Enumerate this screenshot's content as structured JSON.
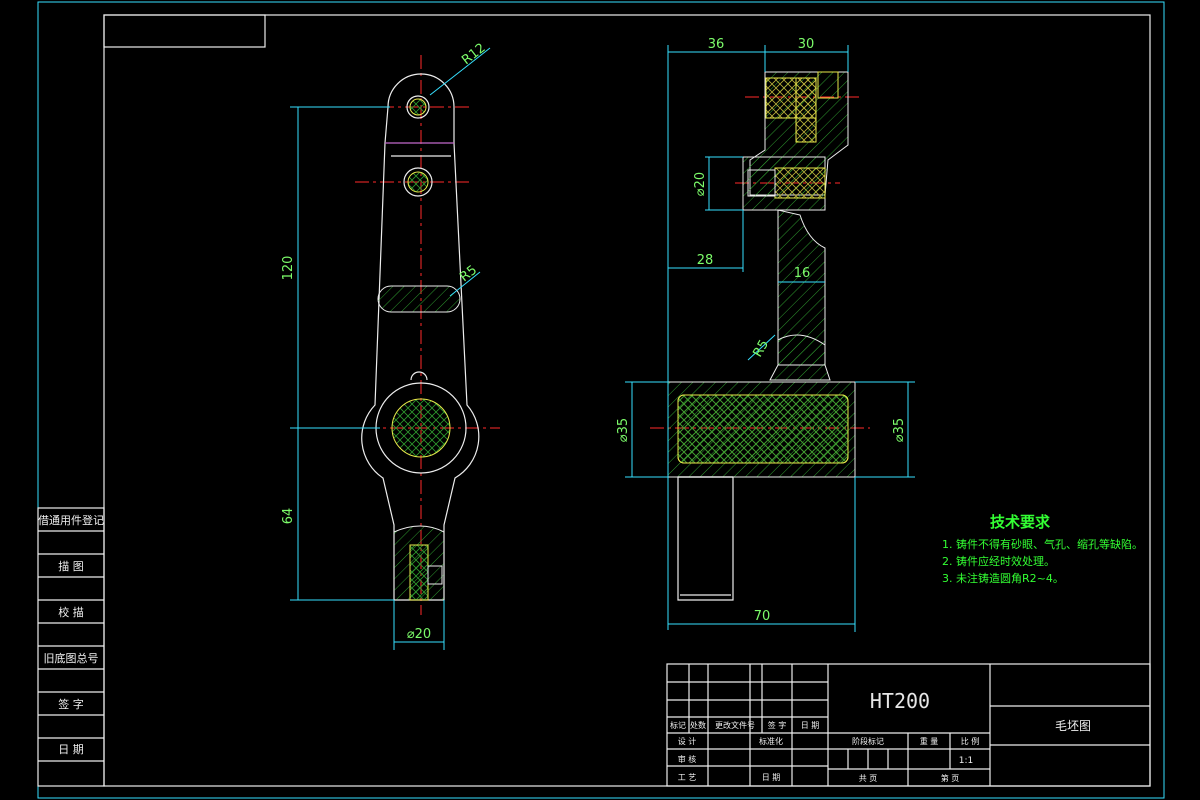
{
  "material": "HT200",
  "drawing_name": "毛坯图",
  "scale": "1:1",
  "tech_requirements": {
    "title": "技术要求",
    "items": [
      "1. 铸件不得有砂眼、气孔、缩孔等缺陷。",
      "2. 铸件应经时效处理。",
      "3. 未注铸造圆角R2~4。"
    ]
  },
  "left_side_labels": [
    "借通用件登记",
    "描 图",
    "校 描",
    "旧底图总号",
    "签 字",
    "日 期"
  ],
  "title_block": {
    "row_labels": [
      "标记",
      "处数",
      "更改文件号",
      "签 字",
      "日 期"
    ],
    "design": "设 计",
    "standardize": "标准化",
    "review": "审 核",
    "process": "工 艺",
    "date": "日 期",
    "stage_mark": "阶段标记",
    "weight": "重 量",
    "scale_label": "比 例",
    "total_pages": "共 页",
    "page_no": "第 页"
  },
  "front_view_dims": {
    "r12": "R12",
    "r5": "R5",
    "len120": "120",
    "len64": "64",
    "dia20": "⌀20"
  },
  "side_view_dims": {
    "w36": "36",
    "w30": "30",
    "dia20": "⌀20",
    "w28": "28",
    "w16": "16",
    "r5": "R5",
    "dia35_left": "⌀35",
    "dia35_right": "⌀35",
    "w70": "70"
  },
  "colors": {
    "background": "#000000",
    "outline": "#EDEDED",
    "dimension": "#36E0FF",
    "centerline": "#FF2A2A",
    "hatch": "#2E9A2E",
    "text": "#7CFC6A"
  }
}
